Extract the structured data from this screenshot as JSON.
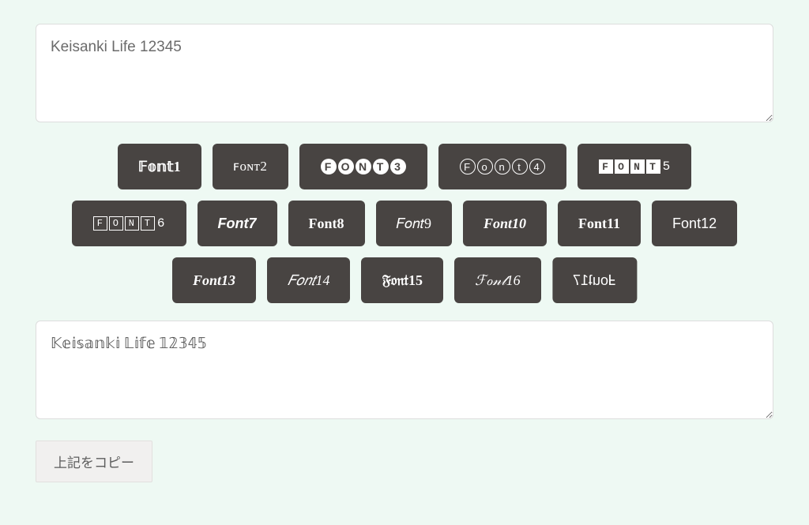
{
  "input": {
    "value": "Keisanki Life 12345"
  },
  "output": {
    "value": "𝕂𝕖𝕚𝕤𝕒𝕟𝕜𝕚 𝕃𝕚𝕗𝕖 𝟙𝟚𝟛𝟜𝟝"
  },
  "buttons": [
    {
      "label": "𝔽𝕠𝕟𝕥1",
      "class": "font-1"
    },
    {
      "label": "ꜰᴏɴᴛ2",
      "class": "font-2"
    },
    {
      "label_chars": [
        "F",
        "O",
        "N",
        "T",
        "3"
      ],
      "class": "font-3",
      "style": "neg-circle"
    },
    {
      "label_chars": [
        "F",
        "o",
        "n",
        "t",
        "4"
      ],
      "class": "font-4",
      "style": "pos-circle"
    },
    {
      "label_chars": [
        "F",
        "O",
        "N",
        "T"
      ],
      "suffix": "5",
      "class": "font-5",
      "style": "neg-square"
    },
    {
      "label_chars": [
        "F",
        "O",
        "N",
        "T"
      ],
      "suffix": "6",
      "class": "font-6",
      "style": "pos-square"
    },
    {
      "label": "Font7",
      "class": "font-7"
    },
    {
      "label": "Font8",
      "class": "font-8"
    },
    {
      "label": "𝐹𝑜𝑛𝑡9",
      "class": "font-9"
    },
    {
      "label": "Font10",
      "class": "font-10"
    },
    {
      "label": "Font11",
      "class": "font-11"
    },
    {
      "label": "Font12",
      "class": "font-12"
    },
    {
      "label": "Font13",
      "class": "font-13"
    },
    {
      "label": "𝐹𝑜𝑛𝑡14",
      "class": "font-14"
    },
    {
      "label": "𝔉𝔬𝔫𝔱15",
      "class": "font-15"
    },
    {
      "label": "ℱℴ𝓃𝓉16",
      "class": "font-16"
    },
    {
      "label": "Ⅎouʇ17",
      "class": "font-17"
    }
  ],
  "copy_button": {
    "label": "上記をコピー"
  }
}
